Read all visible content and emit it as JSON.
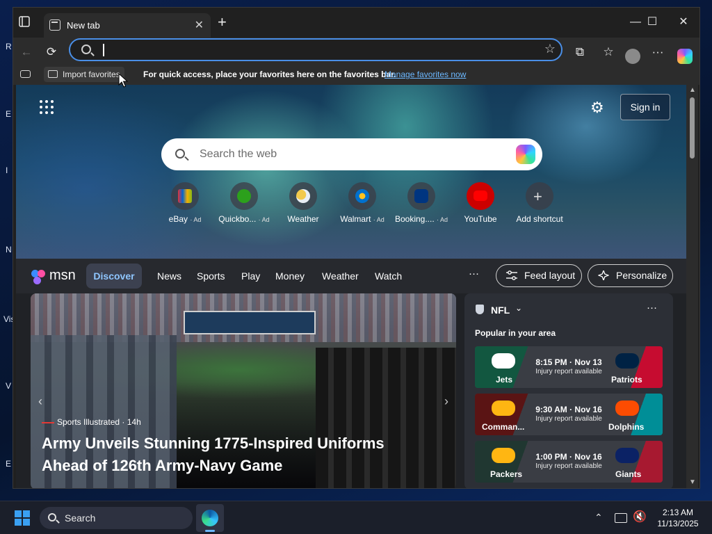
{
  "desktop": {
    "edge_letters": [
      "R",
      "E",
      "I",
      "N",
      "Vis",
      "V",
      "E"
    ]
  },
  "tab": {
    "title": "New tab",
    "close": "✕",
    "new": "+"
  },
  "window_controls": {
    "minimize": "—",
    "maximize": "☐",
    "close": "✕"
  },
  "toolbar": {
    "back": "←",
    "reload": "⟳",
    "address_value": "",
    "star": "☆",
    "extensions": "⧉",
    "favorites": "☆",
    "more": "···"
  },
  "favbar": {
    "import_label": "Import favorites",
    "message": "For quick access, place your favorites here on the favorites bar.",
    "link": "Manage favorites now"
  },
  "ntp": {
    "gear": "⚙",
    "signin": "Sign in",
    "search_placeholder": "Search the web",
    "shortcuts": [
      {
        "label": "eBay",
        "ad": "· Ad",
        "color": "#ffffff",
        "icon": "ebay-icon"
      },
      {
        "label": "Quickbo...",
        "ad": "· Ad",
        "color": "#2ca01c",
        "icon": "quickbooks-icon"
      },
      {
        "label": "Weather",
        "ad": "",
        "color": "#f2c94c",
        "icon": "weather-icon"
      },
      {
        "label": "Walmart",
        "ad": "· Ad",
        "color": "#0071ce",
        "icon": "walmart-icon"
      },
      {
        "label": "Booking....",
        "ad": "· Ad",
        "color": "#003580",
        "icon": "booking-icon"
      },
      {
        "label": "YouTube",
        "ad": "",
        "color": "#ff0000",
        "icon": "youtube-icon"
      },
      {
        "label": "Add shortcut",
        "ad": "",
        "color": "#cccccc",
        "icon": "plus-icon"
      }
    ]
  },
  "msn": {
    "logo_text": "msn",
    "nav": [
      "Discover",
      "News",
      "Sports",
      "Play",
      "Money",
      "Weather",
      "Watch"
    ],
    "more": "···",
    "feed_layout": "Feed layout",
    "personalize": "Personalize"
  },
  "hero": {
    "source": "Sports Illustrated",
    "age": "· 14h",
    "title": "Army Unveils Stunning 1775-Inspired Uniforms Ahead of 126th Army-Navy Game"
  },
  "nfl": {
    "name": "NFL",
    "chevron": "⌄",
    "more": "···",
    "popular": "Popular in your area",
    "games": [
      {
        "away": "Jets",
        "home": "Patriots",
        "time": "8:15 PM · Nov 13",
        "note": "Injury report available",
        "away_color": "#125740",
        "home_color": "#c60c30"
      },
      {
        "away": "Comman...",
        "home": "Dolphins",
        "time": "9:30 AM · Nov 16",
        "note": "Injury report available",
        "away_color": "#5a1414",
        "home_color": "#008e97"
      },
      {
        "away": "Packers",
        "home": "Giants",
        "time": "1:00 PM · Nov 16",
        "note": "Injury report available",
        "away_color": "#203731",
        "home_color": "#0b2265"
      }
    ]
  },
  "taskbar": {
    "search": "Search",
    "time": "2:13 AM",
    "date": "11/13/2025",
    "tray_chevron": "⌃"
  }
}
